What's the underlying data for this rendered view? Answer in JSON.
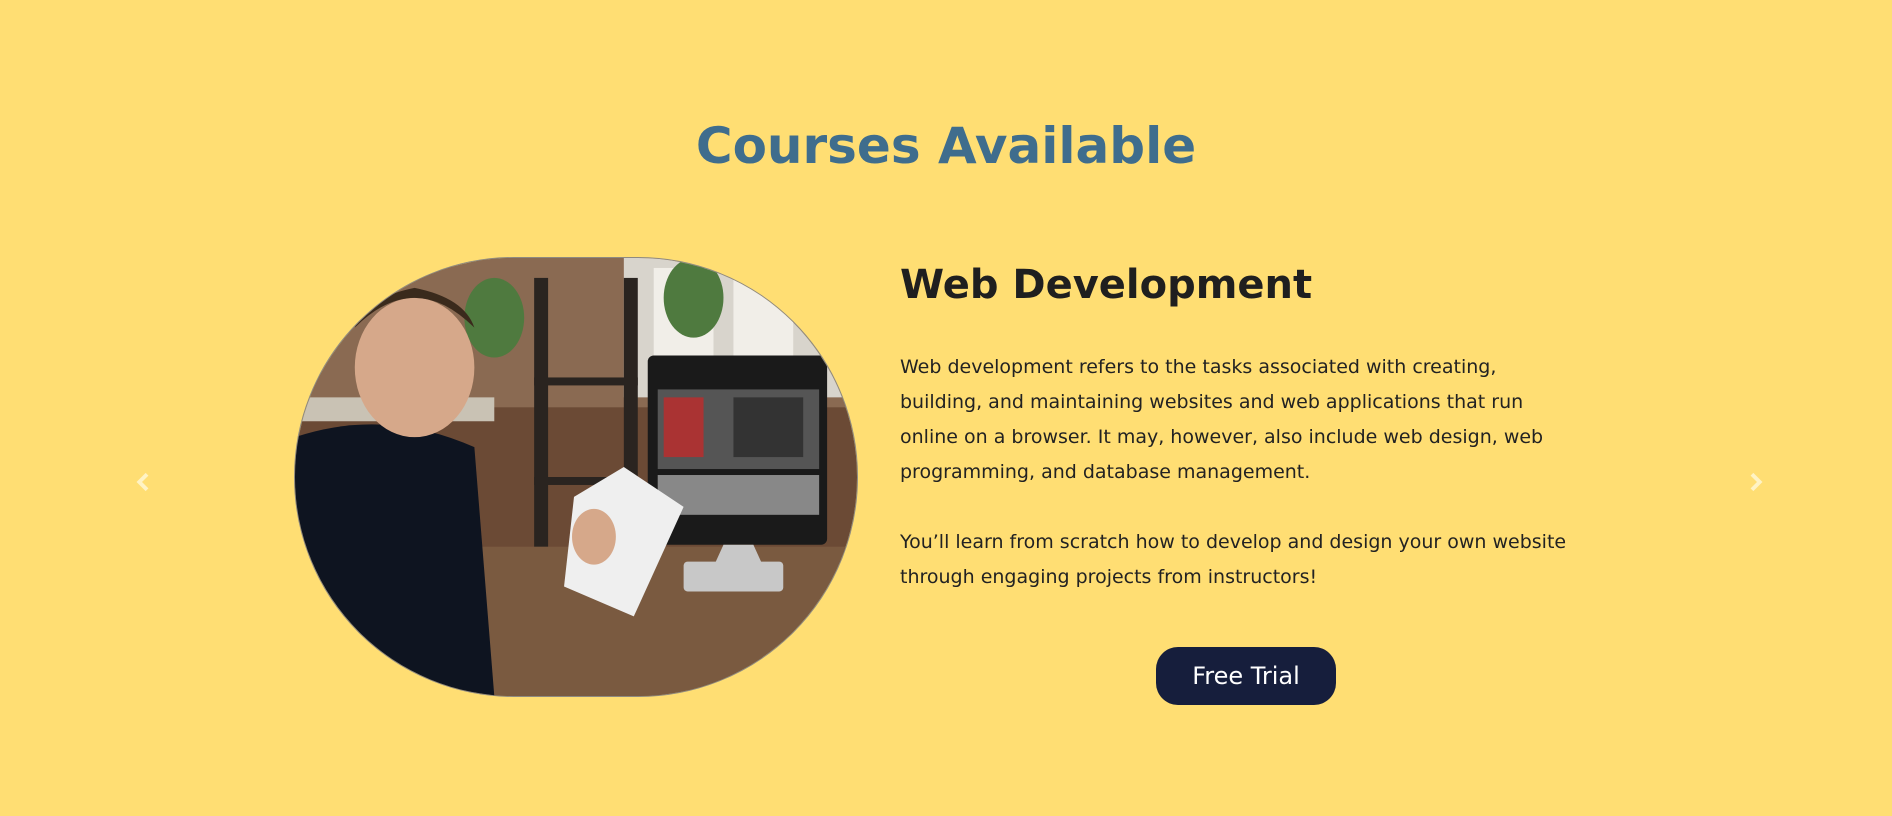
{
  "section": {
    "title": "Courses Available"
  },
  "carousel": {
    "prev_icon": "chevron-left-icon",
    "next_icon": "chevron-right-icon",
    "arrow_color": "#FFF3C4"
  },
  "course": {
    "title": "Web Development",
    "paragraphs": [
      "Web development refers to the tasks associated with creating, building, and maintaining websites and web applications that run online on a browser. It may, however, also include web design, web programming, and database management.",
      "You’ll learn from scratch how to develop and design your own website through engaging projects from instructors!"
    ],
    "cta_label": "Free Trial"
  },
  "colors": {
    "background": "#FFDE73",
    "title": "#3F6D8D",
    "button": "#161E3C"
  }
}
